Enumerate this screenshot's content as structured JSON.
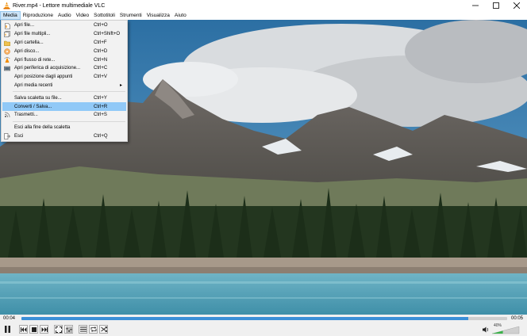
{
  "window": {
    "title": "River.mp4 - Lettore multimediale VLC",
    "controls": [
      "minimize-icon",
      "maximize-icon",
      "close-icon"
    ]
  },
  "menubar": {
    "items": [
      "Media",
      "Riproduzione",
      "Audio",
      "Video",
      "Sottotitoli",
      "Strumenti",
      "Visualizza",
      "Aiuto"
    ],
    "active": "Media"
  },
  "media_menu": {
    "items": [
      {
        "label": "Apri file...",
        "shortcut": "Ctrl+O",
        "icon": "open-file-icon"
      },
      {
        "label": "Apri file multipli...",
        "shortcut": "Ctrl+Shift+O",
        "icon": "open-multiple-files-icon"
      },
      {
        "label": "Apri cartella...",
        "shortcut": "Ctrl+F",
        "icon": "open-folder-icon"
      },
      {
        "label": "Apri disco...",
        "shortcut": "Ctrl+D",
        "icon": "disc-icon"
      },
      {
        "label": "Apri flusso di rete...",
        "shortcut": "Ctrl+N",
        "icon": "network-stream-icon"
      },
      {
        "label": "Apri periferica di acquisizione...",
        "shortcut": "Ctrl+C",
        "icon": "capture-device-icon"
      },
      {
        "label": "Apri posizione dagli appunti",
        "shortcut": "Ctrl+V",
        "icon": ""
      },
      {
        "label": "Apri media recenti",
        "shortcut": "",
        "icon": "",
        "submenu": true
      },
      {
        "separator": true
      },
      {
        "label": "Salva scaletta su file...",
        "shortcut": "Ctrl+Y",
        "icon": ""
      },
      {
        "label": "Converti / Salva...",
        "shortcut": "Ctrl+R",
        "icon": "",
        "highlighted": true
      },
      {
        "label": "Trasmetti...",
        "shortcut": "Ctrl+S",
        "icon": "stream-icon"
      },
      {
        "separator": true
      },
      {
        "label": "Esci alla fine della scaletta",
        "shortcut": "",
        "icon": ""
      },
      {
        "label": "Esci",
        "shortcut": "Ctrl+Q",
        "icon": "exit-icon"
      }
    ]
  },
  "player": {
    "elapsed": "00:04",
    "duration": "00:05",
    "progress": 0.92,
    "volume_label": "40%",
    "volume_level": 0.4
  },
  "colors": {
    "accent": "#3b8fd7",
    "menu_highlight": "#91c9f7",
    "menubar_active": "#cce4f7",
    "vlc_orange": "#f28c00"
  }
}
